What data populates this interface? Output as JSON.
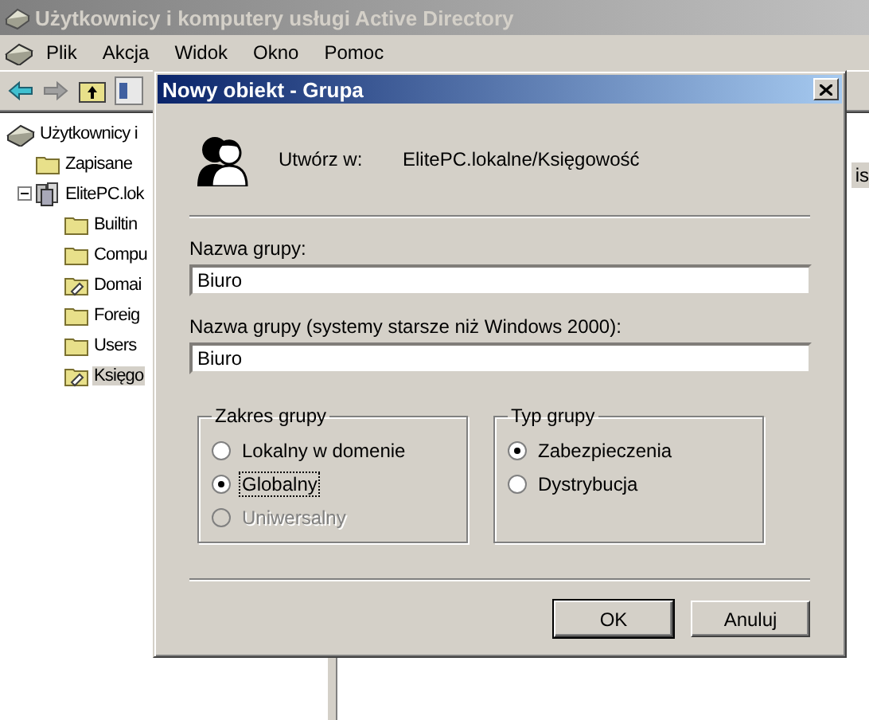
{
  "window": {
    "title": "Użytkownicy i komputery usługi Active Directory"
  },
  "menu": [
    "Plik",
    "Akcja",
    "Widok",
    "Okno",
    "Pomoc"
  ],
  "tree": [
    {
      "label": "Użytkownicy i",
      "kind": "console",
      "selected": false,
      "children": [
        {
          "label": "Zapisane",
          "kind": "folder",
          "selected": false
        },
        {
          "label": "ElitePC.lok",
          "kind": "domain",
          "selected": false,
          "expanded": true,
          "children": [
            {
              "label": "Builtin",
              "kind": "folder",
              "selected": false
            },
            {
              "label": "Compu",
              "kind": "folder",
              "selected": false
            },
            {
              "label": "Domai",
              "kind": "ou",
              "selected": false
            },
            {
              "label": "Foreig",
              "kind": "folder",
              "selected": false
            },
            {
              "label": "Users",
              "kind": "folder",
              "selected": false
            },
            {
              "label": "Księgo",
              "kind": "ou",
              "selected": true
            }
          ]
        }
      ]
    }
  ],
  "list_header_fragment": "is",
  "dialog": {
    "title": "Nowy obiekt - Grupa",
    "create_in_label": "Utwórz w:",
    "create_in_value": "ElitePC.lokalne/Księgowość",
    "fields": [
      {
        "label": "Nazwa grupy:",
        "value": "Biuro"
      },
      {
        "label": "Nazwa grupy (systemy starsze niż Windows 2000):",
        "value": "Biuro"
      }
    ],
    "groups": [
      {
        "title": "Zakres grupy",
        "options": [
          {
            "label": "Lokalny w domenie",
            "selected": false,
            "disabled": false,
            "focused": false
          },
          {
            "label": "Globalny",
            "selected": true,
            "disabled": false,
            "focused": true
          },
          {
            "label": "Uniwersalny",
            "selected": false,
            "disabled": true,
            "focused": false
          }
        ]
      },
      {
        "title": "Typ grupy",
        "options": [
          {
            "label": "Zabezpieczenia",
            "selected": true,
            "disabled": false,
            "focused": false
          },
          {
            "label": "Dystrybucja",
            "selected": false,
            "disabled": false,
            "focused": false
          }
        ]
      }
    ],
    "buttons": [
      {
        "label": "OK",
        "default": true
      },
      {
        "label": "Anuluj",
        "default": false
      }
    ]
  }
}
